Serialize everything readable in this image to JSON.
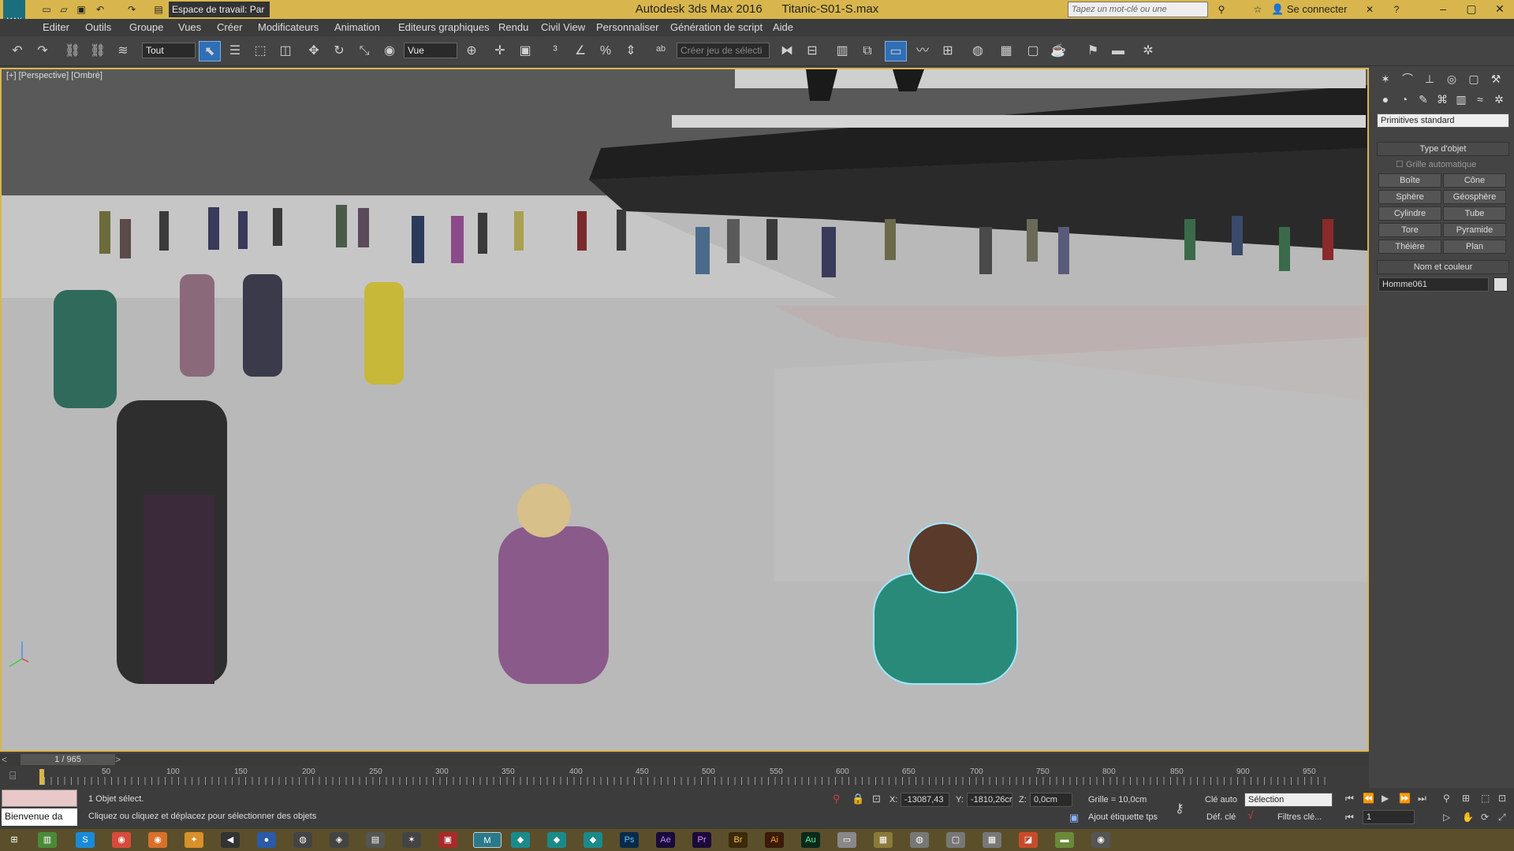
{
  "titlebar": {
    "app_title": "Autodesk 3ds Max 2016",
    "file_name": "Titanic-S01-S.max",
    "workspace": "Espace de travail: Par",
    "search_placeholder": "Tapez un mot-clé ou une expression",
    "sign_in": "Se connecter"
  },
  "menu": [
    "Editer",
    "Outils",
    "Groupe",
    "Vues",
    "Créer",
    "Modificateurs",
    "Animation",
    "Editeurs graphiques",
    "Rendu",
    "Civil View",
    "Personnaliser",
    "Génération de script",
    "Aide"
  ],
  "toolbar": {
    "selection_filter": "Tout",
    "reference_coord": "Vue",
    "named_selection": "Créer jeu de sélecti"
  },
  "viewport": {
    "label": "[+] [Perspective] [Ombré]"
  },
  "command_panel": {
    "category": "Primitives standard",
    "object_type_title": "Type d'objet",
    "auto_grid": "Grille automatique",
    "primitives": [
      "Boîte",
      "Cône",
      "Sphère",
      "Géosphère",
      "Cylindre",
      "Tube",
      "Tore",
      "Pyramide",
      "Théière",
      "Plan"
    ],
    "name_color_title": "Nom et couleur",
    "object_name": "Homme061"
  },
  "timeline": {
    "frame": "1 / 965",
    "ticks": [
      "50",
      "100",
      "150",
      "200",
      "250",
      "300",
      "350",
      "400",
      "450",
      "500",
      "550",
      "600",
      "650",
      "700",
      "750",
      "800",
      "850",
      "900",
      "950"
    ]
  },
  "status": {
    "welcome": "Bienvenue da",
    "selection_info": "1 Objet sélect.",
    "prompt": "Cliquez ou cliquez et déplacez pour sélectionner des objets",
    "x_label": "X:",
    "x_value": "-13087,43",
    "y_label": "Y:",
    "y_value": "-1810,26cr",
    "z_label": "Z:",
    "z_value": "0,0cm",
    "grid": "Grille = 10,0cm",
    "add_time_tag": "Ajout étiquette tps",
    "auto_key": "Clé auto",
    "set_key": "Déf. clé",
    "selection_set": "Sélection",
    "key_filters": "Filtres clé...",
    "current_frame": "1"
  }
}
